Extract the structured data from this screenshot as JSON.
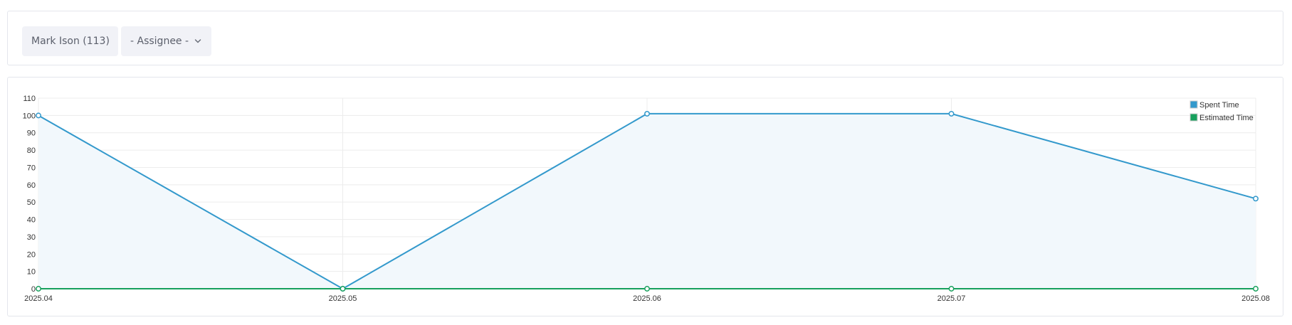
{
  "filters": {
    "user_dropdown": {
      "label": "Mark Ison (113)",
      "icon": "chevron-down-icon"
    },
    "assignee_dropdown": {
      "label": "- Assignee -",
      "icon": "chevron-down-icon"
    }
  },
  "colors": {
    "spent": "#3399cc",
    "estimated": "#17a05d",
    "grid": "#ececec",
    "fill": "#f2f8fc"
  },
  "chart_data": {
    "type": "line",
    "categories": [
      "2025.04",
      "2025.05",
      "2025.06",
      "2025.07",
      "2025.08"
    ],
    "series": [
      {
        "name": "Spent Time",
        "values": [
          100,
          0,
          101,
          101,
          52
        ]
      },
      {
        "name": "Estimated Time",
        "values": [
          0,
          0,
          0,
          0,
          0
        ]
      }
    ],
    "y_ticks": [
      0,
      10,
      20,
      30,
      40,
      50,
      60,
      70,
      80,
      90,
      100,
      110
    ],
    "ylim": [
      0,
      110
    ],
    "grid": true,
    "legend_position": "top-right",
    "title": "",
    "xlabel": "",
    "ylabel": ""
  }
}
